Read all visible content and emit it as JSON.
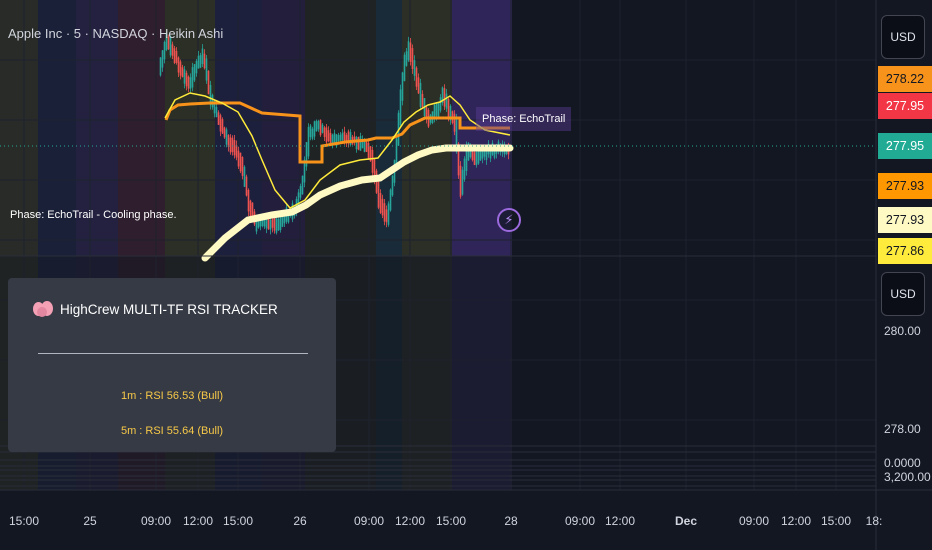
{
  "symbol_title": "Apple Inc · 5 · NASDAQ · Heikin Ashi",
  "currency_top": "USD",
  "currency_bottom": "USD",
  "price_tags": [
    {
      "label": "278.22",
      "bg": "#f7931a",
      "fg": "#131722"
    },
    {
      "label": "277.95",
      "bg": "#f23645",
      "fg": "#ffffff"
    },
    {
      "label": "277.95",
      "bg": "#22ab94",
      "fg": "#ffffff"
    },
    {
      "label": "277.93",
      "bg": "#ff9800",
      "fg": "#131722"
    },
    {
      "label": "277.93",
      "bg": "#fff9c4",
      "fg": "#131722"
    },
    {
      "label": "277.86",
      "bg": "#ffeb3b",
      "fg": "#131722"
    }
  ],
  "lower_scale": [
    "280.00",
    "278.00",
    "0.0000",
    "3,200.00"
  ],
  "phase_label": "Phase: EchoTrail",
  "phase_note": "Phase: EchoTrail - Cooling phase.",
  "tracker": {
    "title": "HighCrew MULTI-TF RSI TRACKER",
    "lines": [
      "1m : RSI 56.53 (Bull)",
      "5m : RSI 55.64 (Bull)"
    ]
  },
  "time_axis": [
    {
      "label": "15:00",
      "bold": false
    },
    {
      "label": "25",
      "bold": false
    },
    {
      "label": "09:00",
      "bold": false
    },
    {
      "label": "12:00",
      "bold": false
    },
    {
      "label": "15:00",
      "bold": false
    },
    {
      "label": "26",
      "bold": false
    },
    {
      "label": "09:00",
      "bold": false
    },
    {
      "label": "12:00",
      "bold": false
    },
    {
      "label": "15:00",
      "bold": false
    },
    {
      "label": "28",
      "bold": false
    },
    {
      "label": "09:00",
      "bold": false
    },
    {
      "label": "12:00",
      "bold": false
    },
    {
      "label": "Dec",
      "bold": true
    },
    {
      "label": "09:00",
      "bold": false
    },
    {
      "label": "12:00",
      "bold": false
    },
    {
      "label": "15:00",
      "bold": false
    },
    {
      "label": "18:",
      "bold": false
    }
  ],
  "colors": {
    "bull": "#26a69a",
    "bear": "#ef5350",
    "orange_line": "#f7931a",
    "yellow_line": "#ffeb3b",
    "cream_line": "#fff9c4",
    "dotted_price_line": "#22ab94"
  }
}
